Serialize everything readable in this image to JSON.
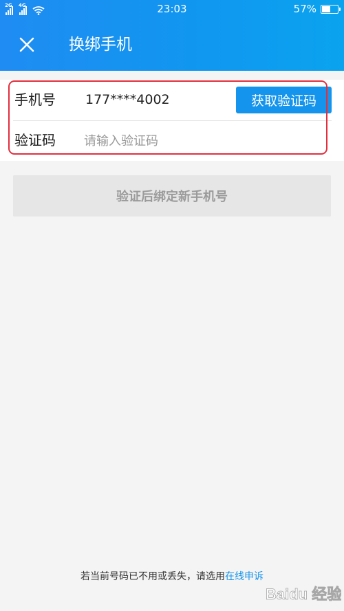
{
  "status_bar": {
    "signal_tag_1": "2G",
    "signal_tag_2": "4G",
    "time": "23:03",
    "battery_percent": "57%",
    "battery_level": 0.57,
    "wifi_icon": "wifi-icon"
  },
  "header": {
    "title": "换绑手机",
    "close_icon": "close-icon"
  },
  "form": {
    "phone_label": "手机号",
    "phone_value": "177****4002",
    "get_code_label": "获取验证码",
    "code_label": "验证码",
    "code_placeholder": "请输入验证码",
    "code_value": ""
  },
  "submit": {
    "label": "验证后绑定新手机号"
  },
  "footer": {
    "text": "若当前号码已不用或丢失，请选用",
    "link": "在线申诉"
  },
  "watermark": {
    "text": "Baidu 经验"
  },
  "colors": {
    "header_start": "#1f8cf3",
    "header_end": "#0aa3ef",
    "accent": "#1494ec",
    "highlight": "#e32e3c",
    "disabled_bg": "#e6e6e6",
    "disabled_text": "#9b9b9b",
    "page_bg": "#f4f4f4"
  }
}
